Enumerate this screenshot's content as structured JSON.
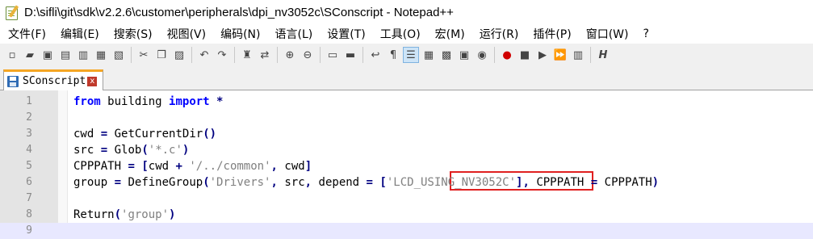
{
  "window": {
    "title": "D:\\sifli\\git\\sdk\\v2.2.6\\customer\\peripherals\\dpi_nv3052c\\SConscript - Notepad++"
  },
  "menu": [
    "文件(F)",
    "编辑(E)",
    "搜索(S)",
    "视图(V)",
    "编码(N)",
    "语言(L)",
    "设置(T)",
    "工具(O)",
    "宏(M)",
    "运行(R)",
    "插件(P)",
    "窗口(W)",
    "?"
  ],
  "toolbar": {
    "icons": [
      "new-file-icon",
      "open-file-icon",
      "save-icon",
      "save-all-icon",
      "close-icon",
      "close-all-icon",
      "print-icon",
      "cut-icon",
      "copy-icon",
      "paste-icon",
      "undo-icon",
      "redo-icon",
      "find-icon",
      "replace-icon",
      "zoom-in-icon",
      "zoom-out-icon",
      "sync-vertical-icon",
      "sync-horizontal-icon",
      "word-wrap-icon",
      "show-all-chars-icon",
      "indent-guide-icon",
      "doc-map-icon",
      "function-list-icon",
      "folder-workspace-icon",
      "monitor-icon",
      "record-macro-icon",
      "stop-macro-icon",
      "play-macro-icon",
      "run-macro-multiple-icon",
      "save-macro-icon",
      "spell-check-icon"
    ],
    "glyphs": [
      "▫",
      "▰",
      "▣",
      "▤",
      "▥",
      "▦",
      "▧",
      "✂",
      "❐",
      "▨",
      "↶",
      "↷",
      "♜",
      "⇄",
      "⊕",
      "⊖",
      "▭",
      "▬",
      "↩",
      "¶",
      "☰",
      "▦",
      "▩",
      "▣",
      "◉",
      "●",
      "■",
      "▶",
      "⏩",
      "▥",
      "H"
    ]
  },
  "tab": {
    "label": "SConscript",
    "close": "x"
  },
  "editor": {
    "lines": [
      {
        "num": "1",
        "text": "from building import *"
      },
      {
        "num": "2",
        "text": ""
      },
      {
        "num": "3",
        "text": "cwd = GetCurrentDir()"
      },
      {
        "num": "4",
        "text": "src = Glob('*.c')"
      },
      {
        "num": "5",
        "text": "CPPPATH = [cwd + '/../common', cwd]"
      },
      {
        "num": "6",
        "text": "group = DefineGroup('Drivers', src, depend = ['LCD_USING_NV3052C'], CPPPATH = CPPPATH)"
      },
      {
        "num": "7",
        "text": ""
      },
      {
        "num": "8",
        "text": "Return('group')"
      },
      {
        "num": "9",
        "text": ""
      }
    ]
  },
  "colors": {
    "keyword": "#0000ff",
    "string": "#808080",
    "highlight_box": "#e02020",
    "tab_accent": "#f5a623"
  }
}
